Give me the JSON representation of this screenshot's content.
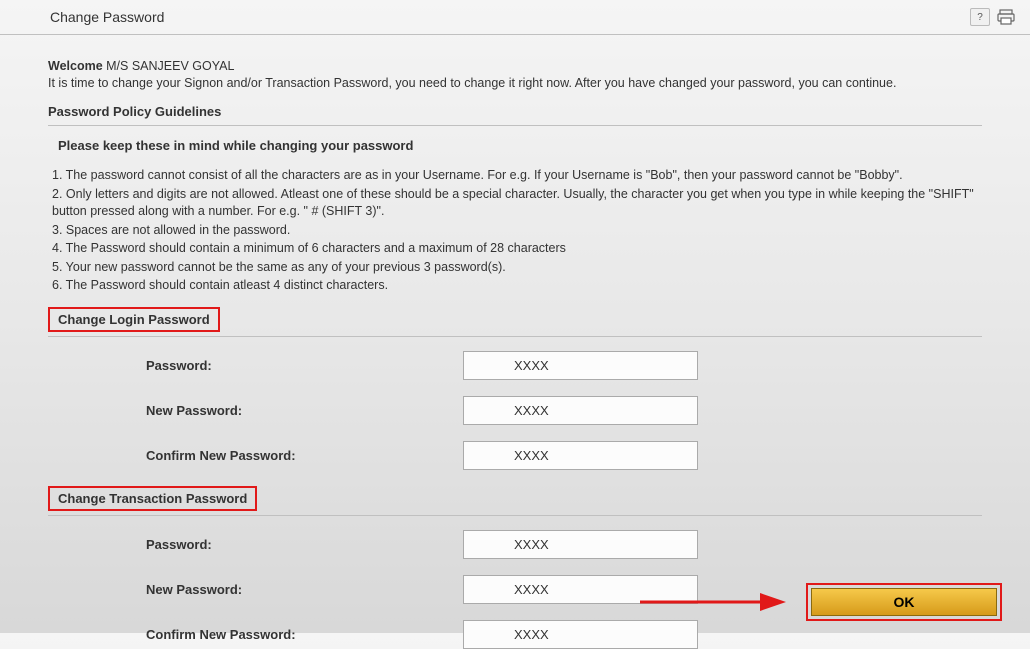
{
  "header": {
    "title": "Change Password"
  },
  "welcome": {
    "label": "Welcome",
    "username": "M/S  SANJEEV  GOYAL"
  },
  "intro": "It is time to change your Signon and/or Transaction Password, you need to change it right now. After you have changed your password, you can continue.",
  "policy": {
    "heading": "Password Policy Guidelines",
    "reminder": "Please keep these in mind while changing your password",
    "rules": [
      "1. The password cannot consist of all the characters are as in your Username. For e.g. If your Username is \"Bob\", then your password cannot be \"Bobby\".",
      "2. Only letters and digits are not allowed. Atleast one of these should be a special character. Usually, the character you get when you type in while keeping the \"SHIFT\" button pressed along with a number. For e.g. \" # (SHIFT 3)\".",
      "3. Spaces are not allowed in the password.",
      "4. The Password should contain a minimum of 6 characters and a maximum of 28 characters",
      "5. Your new password cannot be the same as any of your previous 3 password(s).",
      "6. The Password should contain atleast 4 distinct characters."
    ]
  },
  "login_section": {
    "title": "Change Login Password",
    "fields": {
      "password": {
        "label": "Password:",
        "value": "XXXX"
      },
      "new_password": {
        "label": "New Password:",
        "value": "XXXX"
      },
      "confirm": {
        "label": "Confirm New Password:",
        "value": "XXXX"
      }
    }
  },
  "txn_section": {
    "title": "Change Transaction Password",
    "fields": {
      "password": {
        "label": "Password:",
        "value": "XXXX"
      },
      "new_password": {
        "label": "New Password:",
        "value": "XXXX"
      },
      "confirm": {
        "label": "Confirm New Password:",
        "value": "XXXX"
      }
    }
  },
  "actions": {
    "ok": "OK"
  }
}
